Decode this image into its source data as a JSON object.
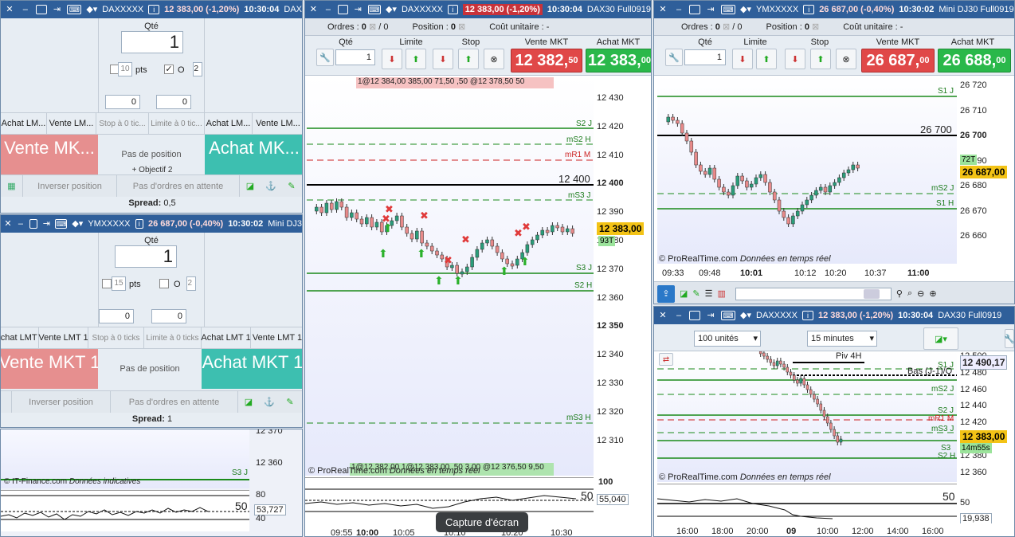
{
  "win_left_top": {
    "instrument": "DAXXXXX",
    "change": "12 383,00 (-1,20%)",
    "time": "10:30:04",
    "extra": "DAX",
    "qty_label": "Qté",
    "qty": "1",
    "pts": "10",
    "pts_unit": "pts",
    "o_label": "O",
    "o_value": "2",
    "stepper1": "0",
    "stepper2": "0",
    "cols": [
      "Achat LM...",
      "Vente LM...",
      "Stop à 0 tic...",
      "Limite à 0 tic...",
      "Achat LM...",
      "Vente LM..."
    ],
    "sell_label": "Vente MK...",
    "no_position": "Pas de position",
    "buy_label": "Achat MK...",
    "objectif": "+ Objectif 2",
    "inverse": "Inverser position",
    "no_orders": "Pas d'ordres en attente",
    "spread_label": "Spread:",
    "spread": "0,5"
  },
  "win_left_bottom": {
    "instrument": "YMXXXXX",
    "change": "26 687,00 (-0,40%)",
    "time": "10:30:02",
    "extra": "Mini DJ3",
    "qty_label": "Qté",
    "qty": "1",
    "pts": "15",
    "pts_unit": "pts",
    "o_label": "O",
    "o_value": "2",
    "stepper1": "0",
    "stepper2": "0",
    "cols": [
      "Achat LMT 1",
      "Vente LMT 1",
      "Stop à 0 ticks",
      "Limite à 0 ticks",
      "Achat LMT 1",
      "Vente LMT 1"
    ],
    "sell_label": "Vente MKT 1",
    "no_position": "Pas de position",
    "buy_label": "Achat MKT 1",
    "inverse": "Inverser position",
    "no_orders": "Pas d'ordres en attente",
    "spread_label": "Spread:",
    "spread": "1"
  },
  "left_chart": {
    "y1": "12 370",
    "y2": "12 360",
    "s3": "S3 J",
    "footer_src": "© IT-Finance.com",
    "footer_note": "Données indicatives",
    "osc_top": "80",
    "osc_mid": "50",
    "osc_bot": "40",
    "osc_val": "53,727"
  },
  "win_mid": {
    "instrument": "DAXXXXX",
    "change": "12 383,00 (-1,20%)",
    "time": "10:30:04",
    "extra": "DAX30 Full0919",
    "orders_label": "Ordres :",
    "orders": "0",
    "position_label": "Position :",
    "position": "0",
    "cost_label": "Coût unitaire :",
    "cost": "-",
    "qty_label": "Qté",
    "limit_label": "Limite",
    "stop_label": "Stop",
    "sell_label": "Vente MKT",
    "buy_label": "Achat MKT",
    "qty": "1",
    "sell_price": "12 382,",
    "sell_dec": "50",
    "buy_price": "12 383,",
    "buy_dec": "00",
    "order_strip": "1@12 384,00   385,00 71,50   ,50  @12 378,50 50",
    "bottom_strip": "1@12 382,00 1@12 383,00 ,50  3,00  @12 376,50    9,50",
    "yticks": [
      "12 430",
      "12 420",
      "12 410",
      "12 400",
      "12 390",
      "12 380",
      "12 370",
      "12 360",
      "12 350",
      "12 340",
      "12 330",
      "12 320",
      "12 310"
    ],
    "s2": "S2 J",
    "ms2h": "mS2 H",
    "mr1m": "mR1 M",
    "level": "12 400",
    "ms3j": "mS3 J",
    "s3j": "S3 J",
    "s2h": "S2 H",
    "ms3h": "mS3 H",
    "price": "12 383,00",
    "price_time": "93T",
    "footer_src": "© ProRealTime.com",
    "footer_note": "Données en temps réel",
    "osc_top": "100",
    "osc_mid": "50",
    "osc_val": "55,040",
    "xticks": [
      "09:55",
      "10:00",
      "10:05",
      "10:10",
      "10:15",
      "10:20",
      "10:30"
    ],
    "tooltip": "Capture d'écran"
  },
  "win_right_top": {
    "instrument": "YMXXXXX",
    "change": "26 687,00 (-0,40%)",
    "time": "10:30:02",
    "extra": "Mini DJ30 Full0919",
    "orders_label": "Ordres :",
    "orders": "0",
    "position_label": "Position :",
    "position": "0",
    "cost_label": "Coût unitaire :",
    "cost": "-",
    "qty_label": "Qté",
    "limit_label": "Limite",
    "stop_label": "Stop",
    "sell_label": "Vente MKT",
    "buy_label": "Achat MKT",
    "qty": "1",
    "sell_price": "26 687,",
    "sell_dec": "00",
    "buy_price": "26 688,",
    "buy_dec": "00",
    "yticks": [
      "26 720",
      "26 710",
      "26 700",
      "26 690",
      "26 680",
      "26 670",
      "26 660"
    ],
    "s1j": "S1 J",
    "level": "26 700",
    "ms2j": "mS2 J",
    "s1h": "S1 H",
    "price": "26 687,00",
    "price_time": "72T",
    "footer_src": "© ProRealTime.com",
    "footer_note": "Données en temps réel",
    "xticks": [
      "09:33",
      "09:48",
      "10:01",
      "10:12",
      "10:20",
      "10:37",
      "11:00"
    ]
  },
  "win_right_bottom": {
    "instrument": "DAXXXXX",
    "change": "12 383,00 (-1,20%)",
    "time": "10:30:04",
    "extra": "DAX30 Full0919",
    "units": "100 unités",
    "interval": "15 minutes",
    "yticks": [
      "12 500",
      "12 480",
      "12 460",
      "12 440",
      "12 420",
      "12 400",
      "12 380",
      "12 360"
    ],
    "piv": "Piv 4H",
    "bas": "Bas (J-1)/Q",
    "s1j": "S1 J",
    "ms2j": "mS2 J",
    "s2j": "S2 J",
    "mr1m": "mR1 M",
    "ms3j": "mS3 J",
    "s3": "S3",
    "s2h": "S2 H",
    "top_price": "12 490,17",
    "price": "12 383,00",
    "price_time": "14m55s",
    "footer_src": "© ProRealTime.com",
    "footer_note": "Données en temps réel",
    "osc_mid": "50",
    "osc_val": "19,938",
    "xticks": [
      "16:00",
      "18:00",
      "20:00",
      "09",
      "10:00",
      "12:00",
      "14:00",
      "16:00"
    ]
  }
}
